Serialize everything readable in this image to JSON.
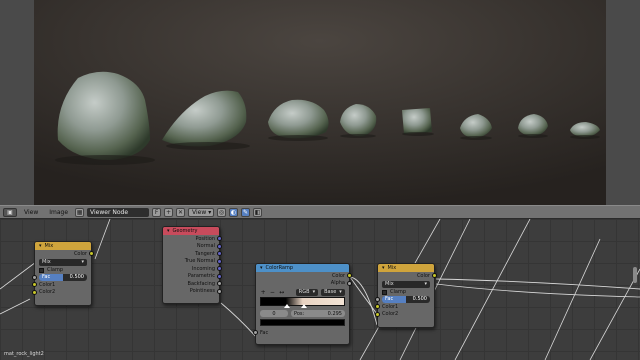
{
  "image_header": {
    "menus": [
      "View",
      "Image"
    ],
    "image_name": "Viewer Node",
    "view_select": "View"
  },
  "nodes": {
    "mix_left": {
      "title": "Mix",
      "output": "Color",
      "blend_mode": "Mix",
      "clamp_label": "Clamp",
      "fac_label": "Fac",
      "fac_value": "0.500",
      "fac_fraction": 0.5,
      "color1": "Color1",
      "color2": "Color2"
    },
    "geometry": {
      "title": "Geometry",
      "outputs": [
        "Position",
        "Normal",
        "Tangent",
        "True Normal",
        "Incoming",
        "Parametric",
        "Backfacing",
        "Pointiness"
      ]
    },
    "colorramp": {
      "title": "ColorRamp",
      "outputs": [
        "Color",
        "Alpha"
      ],
      "tools": [
        "+",
        "−",
        "↔"
      ],
      "color_mode": "RGB",
      "interpolation": "Base",
      "stop_index": "0",
      "pos_label": "Pos:",
      "pos_value": "0.295",
      "input": "Fac"
    },
    "mix_right": {
      "title": "Mix",
      "output": "Color",
      "blend_mode": "Mix",
      "clamp_label": "Clamp",
      "fac_label": "Fac",
      "fac_value": "0.500",
      "fac_fraction": 0.5,
      "color1": "Color1",
      "color2": "Color2"
    }
  },
  "material_name": "mat_rock_light2",
  "colors": {
    "mix_header": "#cfa43c",
    "geometry_header": "#c84b5c",
    "colorramp_header": "#4d90c8",
    "socket_color": "#c7c729",
    "socket_vector": "#6363c7",
    "socket_float": "#a1a1a1",
    "accent": "#5680c2"
  }
}
